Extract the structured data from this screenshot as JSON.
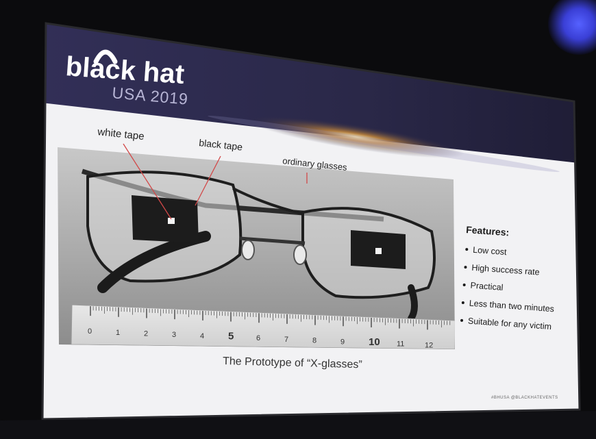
{
  "conference": {
    "logo_word": "black hat",
    "edition": "USA 2019",
    "footer_tags": "#BHUSA  @BLACKHATEVENTS"
  },
  "photo_labels": {
    "white_tape": "white tape",
    "black_tape": "black tape",
    "ordinary_glasses": "ordinary glasses"
  },
  "ruler": {
    "numbers": [
      "0",
      "1",
      "2",
      "3",
      "4",
      "5",
      "6",
      "7",
      "8",
      "9",
      "10",
      "11",
      "12"
    ]
  },
  "caption": "The Prototype of “X-glasses”",
  "features": {
    "title": "Features:",
    "items": [
      "Low cost",
      "High success rate",
      "Practical",
      "Less than two minutes",
      "Suitable for any victim"
    ]
  },
  "colors": {
    "slide_background": "#f2f2f4",
    "header_band": "#2c2a4c",
    "room": "#0b0b0d",
    "accent_glow": "#5561ff"
  }
}
